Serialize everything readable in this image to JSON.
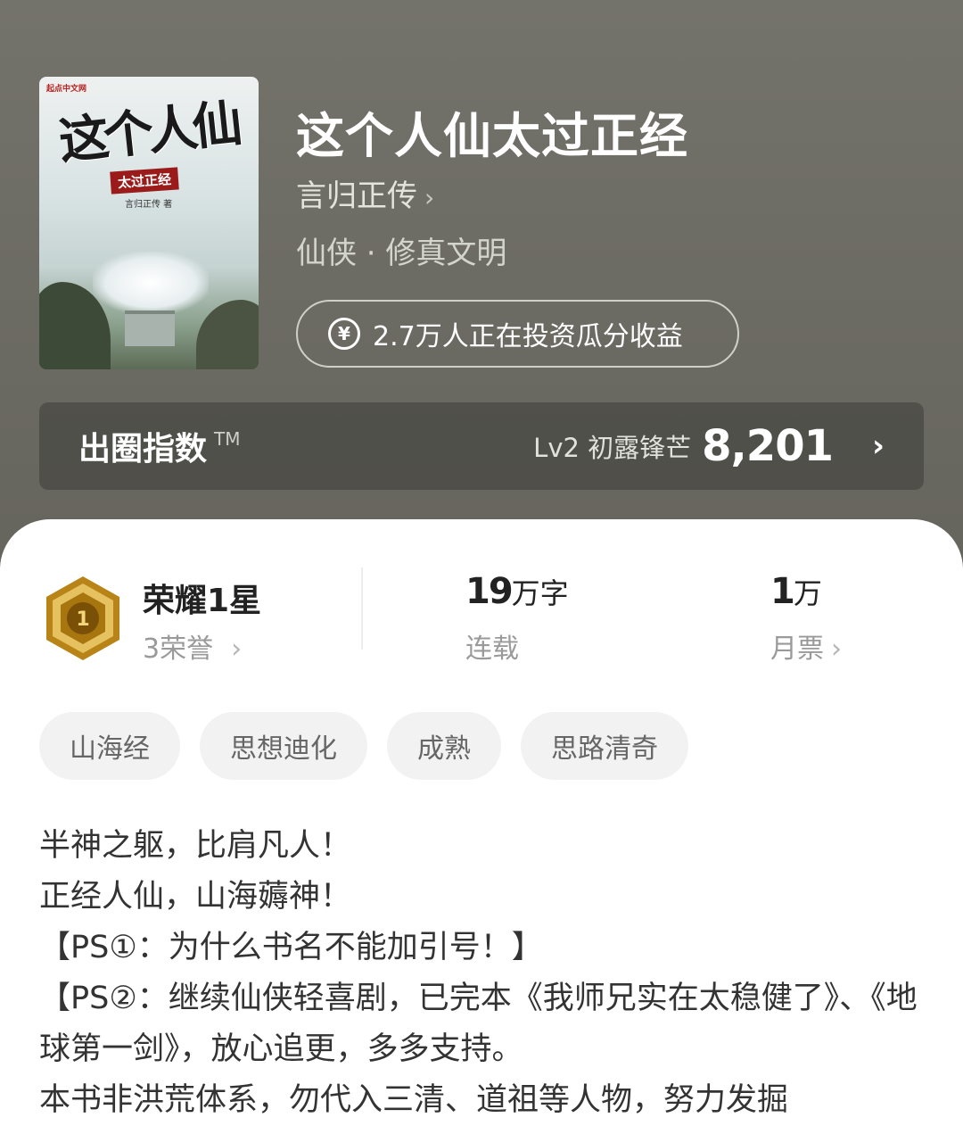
{
  "book": {
    "title": "这个人仙太过正经",
    "author": "言归正传",
    "author_chevron": "›",
    "genre": "仙侠 · 修真文明",
    "invest_icon": "¥",
    "invest_text": "2.7万人正在投资瓜分收益"
  },
  "cover": {
    "publisher": "起点中文网",
    "title": "这个人仙",
    "subtitle": "太过正经",
    "author": "言归正传 著"
  },
  "breakout": {
    "label": "出圈指数",
    "tm": "TM",
    "level": "Lv2 初露锋芒",
    "score": "8,201",
    "chevron": "›"
  },
  "stats": {
    "honor": {
      "badge_number": "1",
      "title": "荣耀1星",
      "sub": "3荣誉",
      "chevron": "›"
    },
    "words": {
      "value": "19",
      "unit": "万字",
      "label": "连载"
    },
    "tickets": {
      "value": "1",
      "unit": "万",
      "label": "月票",
      "chevron": "›"
    }
  },
  "tags": [
    "山海经",
    "思想迪化",
    "成熟",
    "思路清奇"
  ],
  "description": [
    "半神之躯，比肩凡人！",
    "正经人仙，山海薅神！",
    "【PS①：为什么书名不能加引号！】",
    "【PS②：继续仙侠轻喜剧，已完本《我师兄实在太稳健了》、《地球第一剑》，放心追更，多多支持。",
    "本书非洪荒体系，勿代入三清、道祖等人物，努力发掘"
  ],
  "colors": {
    "hero_bg": "#6e6d65",
    "badge_gold": "#c99a2a"
  }
}
